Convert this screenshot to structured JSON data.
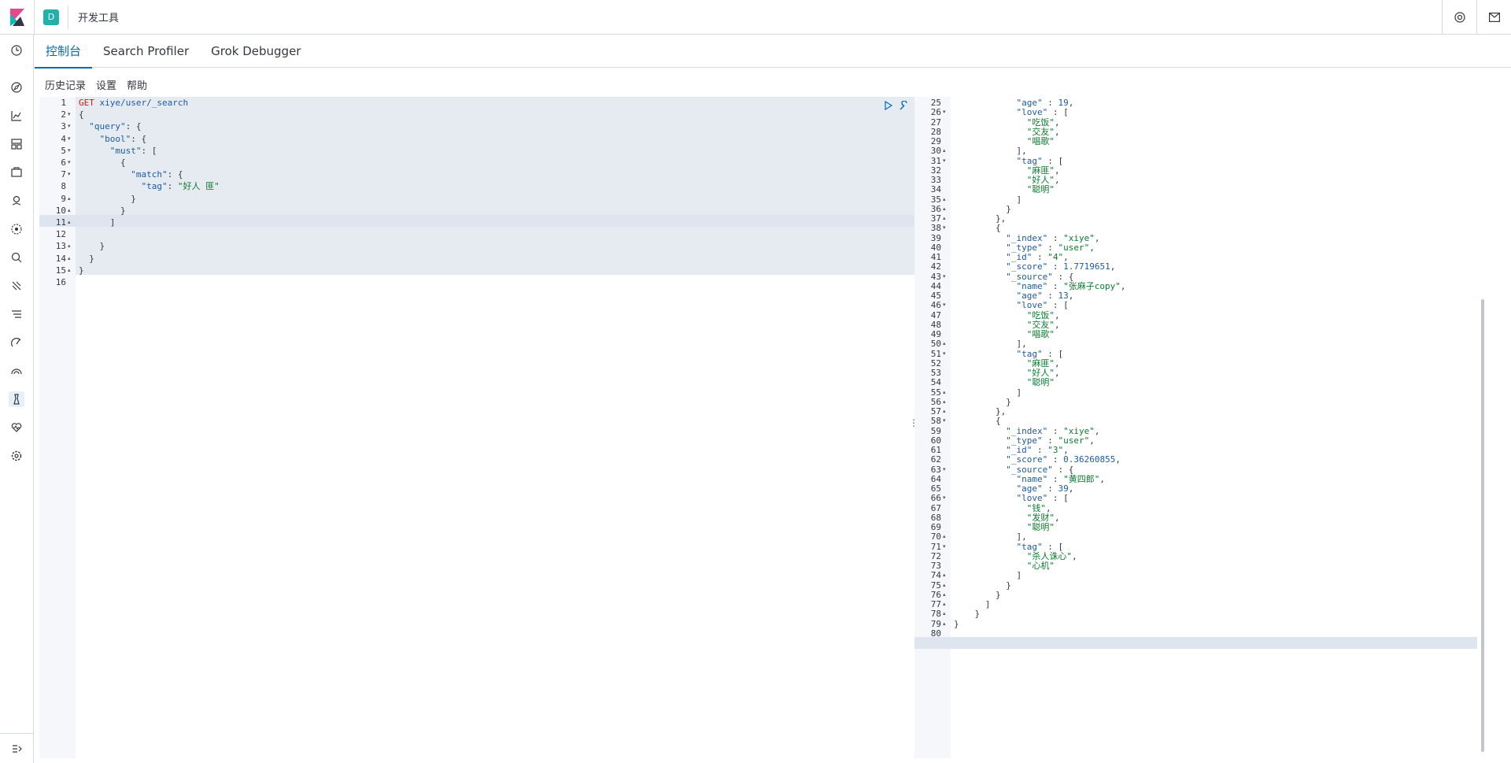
{
  "app": {
    "space_initial": "D",
    "breadcrumb": "开发工具"
  },
  "tabs": [
    {
      "label": "控制台",
      "active": true
    },
    {
      "label": "Search Profiler",
      "active": false
    },
    {
      "label": "Grok Debugger",
      "active": false
    }
  ],
  "subbar": {
    "history": "历史记录",
    "settings": "设置",
    "help": "帮助"
  },
  "request": {
    "method": "GET",
    "path": " xiye/user/_search",
    "lines": [
      {
        "n": "1",
        "fold": "",
        "text": ""
      },
      {
        "n": "2",
        "fold": "▾",
        "text": "{"
      },
      {
        "n": "3",
        "fold": "▾",
        "text": "  \"query\": {"
      },
      {
        "n": "4",
        "fold": "▾",
        "text": "    \"bool\": {"
      },
      {
        "n": "5",
        "fold": "▾",
        "text": "      \"must\": ["
      },
      {
        "n": "6",
        "fold": "▾",
        "text": "        {"
      },
      {
        "n": "7",
        "fold": "▾",
        "text": "          \"match\": {"
      },
      {
        "n": "8",
        "fold": "",
        "text": "            \"tag\": \"好人 匪\""
      },
      {
        "n": "9",
        "fold": "▴",
        "text": "          }"
      },
      {
        "n": "10",
        "fold": "▴",
        "text": "        }"
      },
      {
        "n": "11",
        "fold": "▴",
        "text": "      ]"
      },
      {
        "n": "12",
        "fold": "",
        "text": ""
      },
      {
        "n": "13",
        "fold": "▴",
        "text": "    }"
      },
      {
        "n": "14",
        "fold": "▴",
        "text": "  }"
      },
      {
        "n": "15",
        "fold": "▴",
        "text": "}"
      },
      {
        "n": "16",
        "fold": "",
        "text": ""
      }
    ]
  },
  "response": {
    "lines": [
      {
        "n": "25",
        "fold": "",
        "text": "            \"age\" : 19,"
      },
      {
        "n": "26",
        "fold": "▾",
        "text": "            \"love\" : ["
      },
      {
        "n": "27",
        "fold": "",
        "text": "              \"吃饭\","
      },
      {
        "n": "28",
        "fold": "",
        "text": "              \"交友\","
      },
      {
        "n": "29",
        "fold": "",
        "text": "              \"唱歌\""
      },
      {
        "n": "30",
        "fold": "▴",
        "text": "            ],"
      },
      {
        "n": "31",
        "fold": "▾",
        "text": "            \"tag\" : ["
      },
      {
        "n": "32",
        "fold": "",
        "text": "              \"麻匪\","
      },
      {
        "n": "33",
        "fold": "",
        "text": "              \"好人\","
      },
      {
        "n": "34",
        "fold": "",
        "text": "              \"聪明\""
      },
      {
        "n": "35",
        "fold": "▴",
        "text": "            ]"
      },
      {
        "n": "36",
        "fold": "▴",
        "text": "          }"
      },
      {
        "n": "37",
        "fold": "▴",
        "text": "        },"
      },
      {
        "n": "38",
        "fold": "▾",
        "text": "        {"
      },
      {
        "n": "39",
        "fold": "",
        "text": "          \"_index\" : \"xiye\","
      },
      {
        "n": "40",
        "fold": "",
        "text": "          \"_type\" : \"user\","
      },
      {
        "n": "41",
        "fold": "",
        "text": "          \"_id\" : \"4\","
      },
      {
        "n": "42",
        "fold": "",
        "text": "          \"_score\" : 1.7719651,"
      },
      {
        "n": "43",
        "fold": "▾",
        "text": "          \"_source\" : {"
      },
      {
        "n": "44",
        "fold": "",
        "text": "            \"name\" : \"张麻子copy\","
      },
      {
        "n": "45",
        "fold": "",
        "text": "            \"age\" : 13,"
      },
      {
        "n": "46",
        "fold": "▾",
        "text": "            \"love\" : ["
      },
      {
        "n": "47",
        "fold": "",
        "text": "              \"吃饭\","
      },
      {
        "n": "48",
        "fold": "",
        "text": "              \"交友\","
      },
      {
        "n": "49",
        "fold": "",
        "text": "              \"唱歌\""
      },
      {
        "n": "50",
        "fold": "▴",
        "text": "            ],"
      },
      {
        "n": "51",
        "fold": "▾",
        "text": "            \"tag\" : ["
      },
      {
        "n": "52",
        "fold": "",
        "text": "              \"麻匪\","
      },
      {
        "n": "53",
        "fold": "",
        "text": "              \"好人\","
      },
      {
        "n": "54",
        "fold": "",
        "text": "              \"聪明\""
      },
      {
        "n": "55",
        "fold": "▴",
        "text": "            ]"
      },
      {
        "n": "56",
        "fold": "▴",
        "text": "          }"
      },
      {
        "n": "57",
        "fold": "▴",
        "text": "        },"
      },
      {
        "n": "58",
        "fold": "▾",
        "text": "        {"
      },
      {
        "n": "59",
        "fold": "",
        "text": "          \"_index\" : \"xiye\","
      },
      {
        "n": "60",
        "fold": "",
        "text": "          \"_type\" : \"user\","
      },
      {
        "n": "61",
        "fold": "",
        "text": "          \"_id\" : \"3\","
      },
      {
        "n": "62",
        "fold": "",
        "text": "          \"_score\" : 0.36260855,"
      },
      {
        "n": "63",
        "fold": "▾",
        "text": "          \"_source\" : {"
      },
      {
        "n": "64",
        "fold": "",
        "text": "            \"name\" : \"黄四郎\","
      },
      {
        "n": "65",
        "fold": "",
        "text": "            \"age\" : 39,"
      },
      {
        "n": "66",
        "fold": "▾",
        "text": "            \"love\" : ["
      },
      {
        "n": "67",
        "fold": "",
        "text": "              \"钱\","
      },
      {
        "n": "68",
        "fold": "",
        "text": "              \"发财\","
      },
      {
        "n": "69",
        "fold": "",
        "text": "              \"聪明\""
      },
      {
        "n": "70",
        "fold": "▴",
        "text": "            ],"
      },
      {
        "n": "71",
        "fold": "▾",
        "text": "            \"tag\" : ["
      },
      {
        "n": "72",
        "fold": "",
        "text": "              \"杀人诛心\","
      },
      {
        "n": "73",
        "fold": "",
        "text": "              \"心机\""
      },
      {
        "n": "74",
        "fold": "▴",
        "text": "            ]"
      },
      {
        "n": "75",
        "fold": "▴",
        "text": "          }"
      },
      {
        "n": "76",
        "fold": "▴",
        "text": "        }"
      },
      {
        "n": "77",
        "fold": "▴",
        "text": "      ]"
      },
      {
        "n": "78",
        "fold": "▴",
        "text": "    }"
      },
      {
        "n": "79",
        "fold": "▴",
        "text": "}"
      },
      {
        "n": "80",
        "fold": "",
        "text": ""
      }
    ]
  },
  "icons": {
    "logo": "kibana-logo",
    "help": "help-icon",
    "mail": "mail-icon",
    "play": "play-icon",
    "wrench": "wrench-icon"
  },
  "colors": {
    "accent": "#006bb4",
    "space_badge": "#20b2aa",
    "string": "#0a7b2f",
    "method": "#c41a16"
  }
}
